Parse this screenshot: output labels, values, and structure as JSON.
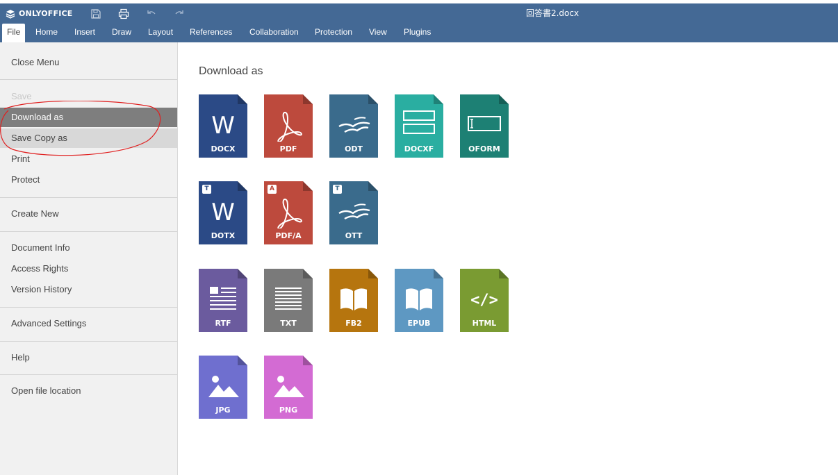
{
  "app": {
    "brand": "ONLYOFFICE",
    "document_title": "回答書2.docx",
    "toolbar_icons": [
      "save-icon",
      "print-icon",
      "undo-icon",
      "redo-icon"
    ]
  },
  "tabs": [
    {
      "label": "File",
      "active": true
    },
    {
      "label": "Home"
    },
    {
      "label": "Insert"
    },
    {
      "label": "Draw"
    },
    {
      "label": "Layout"
    },
    {
      "label": "References"
    },
    {
      "label": "Collaboration"
    },
    {
      "label": "Protection"
    },
    {
      "label": "View"
    },
    {
      "label": "Plugins"
    }
  ],
  "sidebar": {
    "items": [
      {
        "label": "Close Menu"
      },
      {
        "label": "Save",
        "state": "disabled"
      },
      {
        "label": "Download as",
        "state": "selected"
      },
      {
        "label": "Save Copy as",
        "state": "hover"
      },
      {
        "label": "Print"
      },
      {
        "label": "Protect"
      },
      {
        "label": "Create New"
      },
      {
        "label": "Document Info"
      },
      {
        "label": "Access Rights"
      },
      {
        "label": "Version History"
      },
      {
        "label": "Advanced Settings"
      },
      {
        "label": "Help"
      },
      {
        "label": "Open file location"
      }
    ],
    "annotation_color": "#e02020"
  },
  "main": {
    "title": "Download as",
    "formats": [
      {
        "label": "DOCX",
        "color": "#2b4a86",
        "icon": "word-icon"
      },
      {
        "label": "PDF",
        "color": "#bd4a3d",
        "icon": "pdf-icon"
      },
      {
        "label": "ODT",
        "color": "#3a6b8c",
        "icon": "seagull-icon"
      },
      {
        "label": "DOCXF",
        "color": "#2aaea1",
        "icon": "form-fields-icon"
      },
      {
        "label": "OFORM",
        "color": "#1d8074",
        "icon": "oform-icon"
      },
      {
        "label": "DOTX",
        "color": "#2b4a86",
        "icon": "word-icon",
        "badge": "T"
      },
      {
        "label": "PDF/A",
        "color": "#bd4a3d",
        "icon": "pdf-icon",
        "badge": "A"
      },
      {
        "label": "OTT",
        "color": "#3a6b8c",
        "icon": "seagull-icon",
        "badge": "T"
      },
      {
        "label": "RTF",
        "color": "#6b5b9e",
        "icon": "rich-text-icon"
      },
      {
        "label": "TXT",
        "color": "#7a7a7a",
        "icon": "text-lines-icon"
      },
      {
        "label": "FB2",
        "color": "#b6750e",
        "icon": "book-icon"
      },
      {
        "label": "EPUB",
        "color": "#5e98c2",
        "icon": "book-icon"
      },
      {
        "label": "HTML",
        "color": "#7a9b32",
        "icon": "code-icon"
      },
      {
        "label": "JPG",
        "color": "#6f6fcf",
        "icon": "image-icon"
      },
      {
        "label": "PNG",
        "color": "#d36bd3",
        "icon": "image-icon"
      }
    ]
  }
}
